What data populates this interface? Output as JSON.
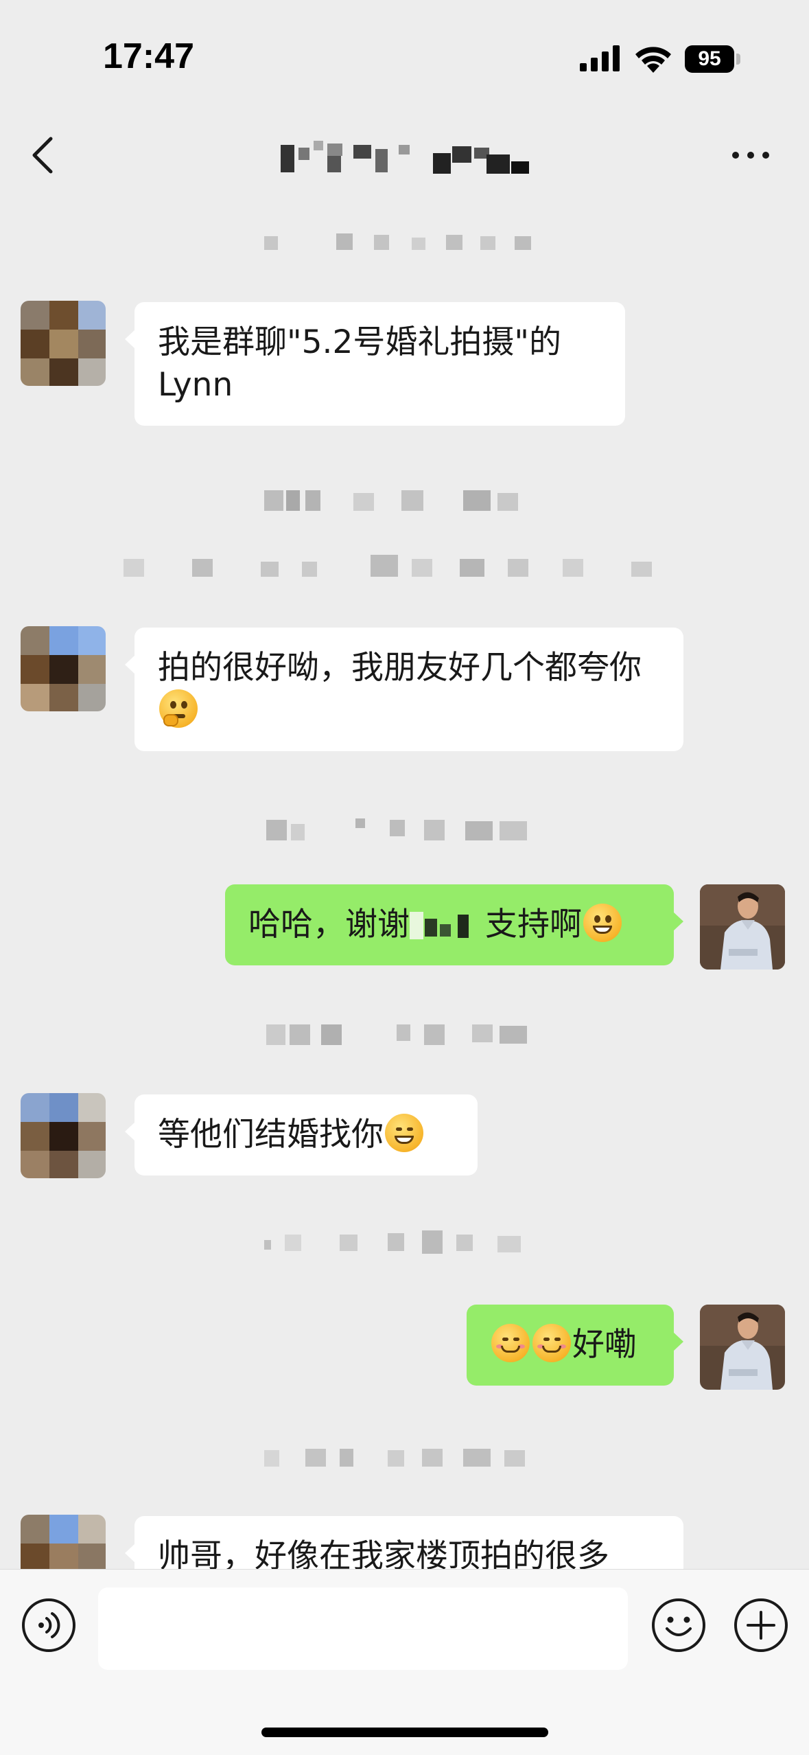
{
  "status_bar": {
    "time": "17:47",
    "battery": "95"
  },
  "nav": {
    "back_icon": "chevron-left-icon",
    "more_icon": "ellipsis-icon"
  },
  "messages": [
    {
      "side": "in",
      "text": "我是群聊\"5.2号婚礼拍摄\"的Lynn"
    },
    {
      "side": "in",
      "text_before": "拍的很好呦，我朋友好几个都夸你",
      "emoji": "thinking-face"
    },
    {
      "side": "out",
      "text_before": "哈哈，谢谢",
      "text_after": "支持啊",
      "emoji": "grinning-face"
    },
    {
      "side": "in",
      "text_before": "等他们结婚找你",
      "emoji": "grinning-squint-face"
    },
    {
      "side": "out",
      "emoji": "smiling-face",
      "text_after": "好嘞"
    },
    {
      "side": "in",
      "text": "帅哥，好像在我家楼顶拍的很多"
    }
  ],
  "input_bar": {
    "voice_icon": "voice-icon",
    "emoji_icon": "emoji-icon",
    "plus_icon": "plus-icon",
    "placeholder": ""
  },
  "colors": {
    "background": "#ededed",
    "bubble_in": "#ffffff",
    "bubble_out": "#95ec69"
  }
}
